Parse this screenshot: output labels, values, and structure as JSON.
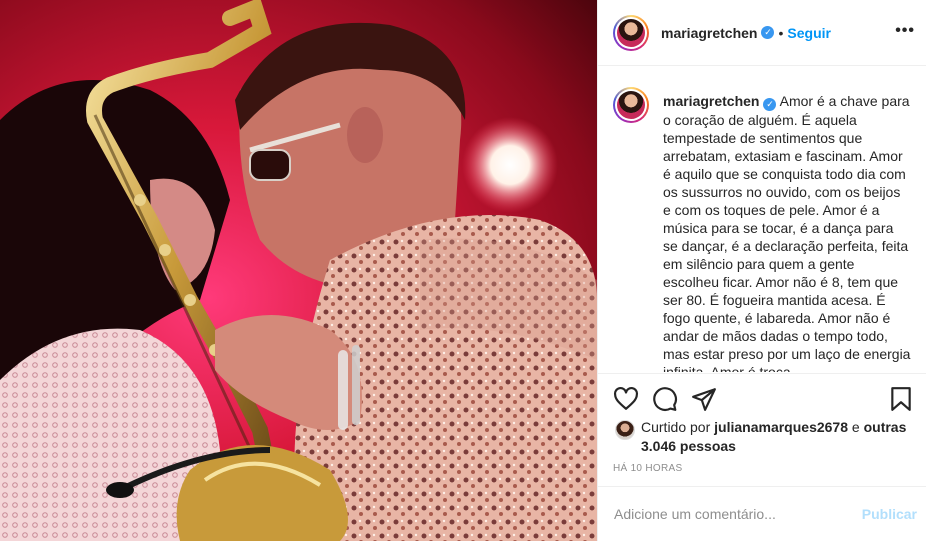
{
  "post": {
    "username": "mariagretchen",
    "verified_icon": "verified-badge-icon",
    "separator": "•",
    "follow_label": "Seguir",
    "more_label": "•••",
    "caption": {
      "username": "mariagretchen",
      "text": "Amor é a chave para o coração de alguém. É aquela tempestade de sentimentos que arrebatam, extasiam e fascinam. Amor é aquilo que se conquista todo dia com os sussurros no ouvido, com os beijos e com os toques de pele. Amor é a música para se tocar, é a dança para se dançar, é a declaração perfeita, feita em silêncio para quem a gente escolheu ficar. Amor não é 8, tem que ser 80. É fogueira mantida acesa. É fogo quente, é labareda. Amor não é andar de mãos dadas o tempo todo, mas estar preso por um laço de energia infinita. Amor é troca"
    },
    "actions": {
      "like_icon": "heart-icon",
      "comment_icon": "comment-icon",
      "share_icon": "share-icon",
      "save_icon": "bookmark-icon"
    },
    "likes": {
      "prefix": "Curtido por",
      "liker": "julianamarques2678",
      "conjunction": "e",
      "others": "outras 3.046 pessoas"
    },
    "timestamp": "HÁ 10 HORAS",
    "comment": {
      "placeholder": "Adicione um comentário...",
      "post_label": "Publicar"
    },
    "colors": {
      "accent": "#0095f6",
      "verified": "#3897f0",
      "post_disabled": "#b2dffc",
      "muted": "#8e8e8e"
    }
  }
}
